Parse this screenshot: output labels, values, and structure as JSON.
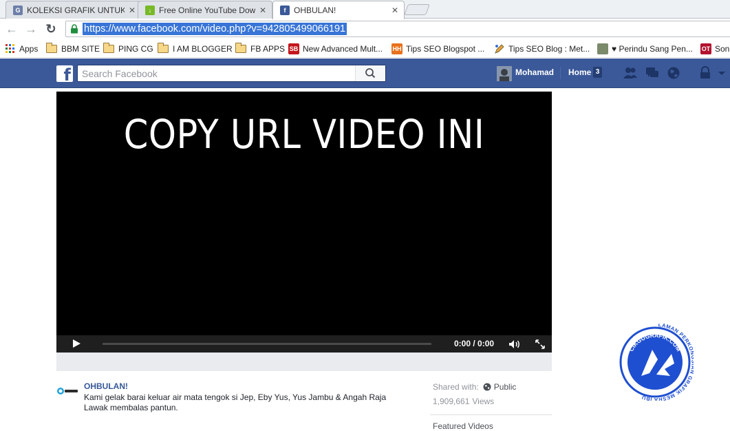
{
  "browser": {
    "tabs": [
      {
        "title": "KOLEKSI GRAFIK UNTUK C",
        "close": "✕",
        "favicon": "grafik-favicon"
      },
      {
        "title": "Free Online YouTube Dow",
        "close": "✕",
        "favicon": "download-arrow-favicon"
      },
      {
        "title": "OHBULAN!",
        "close": "✕",
        "favicon": "facebook-favicon",
        "active": true
      }
    ],
    "back": "←",
    "forward": "→",
    "reload": "↻",
    "url": "https://www.facebook.com/video.php?v=942805499066191"
  },
  "bookmarks": [
    {
      "label": "Apps",
      "icon": "apps-grid-icon"
    },
    {
      "label": "BBM SITE",
      "icon": "folder-icon"
    },
    {
      "label": "PING CG",
      "icon": "folder-icon"
    },
    {
      "label": "I AM BLOGGER",
      "icon": "folder-icon"
    },
    {
      "label": "FB APPS",
      "icon": "folder-icon"
    },
    {
      "label": "New Advanced Mult...",
      "icon": "sb-favicon",
      "icon_text": "SB"
    },
    {
      "label": "Tips SEO Blogspot ...",
      "icon": "hh-favicon",
      "icon_text": "HH"
    },
    {
      "label": "Tips SEO Blog : Met...",
      "icon": "pencil-favicon"
    },
    {
      "label": "♥ Perindu Sang Pen...",
      "icon": "photo-favicon"
    },
    {
      "label": "Son",
      "icon": "ot-favicon",
      "icon_text": "OT"
    }
  ],
  "facebook": {
    "logo": "f",
    "search_placeholder": "Search Facebook",
    "user": "Mohamad",
    "home": "Home",
    "home_count": "3"
  },
  "video": {
    "overlay_text": "COPY URL VIDEO INI",
    "time": "0:00 / 0:00",
    "progress": 0
  },
  "post": {
    "page_name": "OHBULAN!",
    "description": "Kami gelak barai keluar air mata tengok si Jep, Eby Yus, Yus Jambu & Angah Raja Lawak membalas pantun.",
    "shared_with_label": "Shared with:",
    "shared_with_value": "Public",
    "views_count": "1,909,661",
    "views_label": "Views",
    "featured_label": "Featured Videos"
  },
  "watermark": {
    "top_text": "CIKGUGRAFIK.COM",
    "ring_text": "LAMAN PERKONGSIAN GRAFIK MESRA IBU"
  },
  "colors": {
    "facebook_blue": "#3b5998",
    "link_blue": "#365899",
    "selection": "#3875d7",
    "watermark_blue": "#1f4fd1"
  }
}
